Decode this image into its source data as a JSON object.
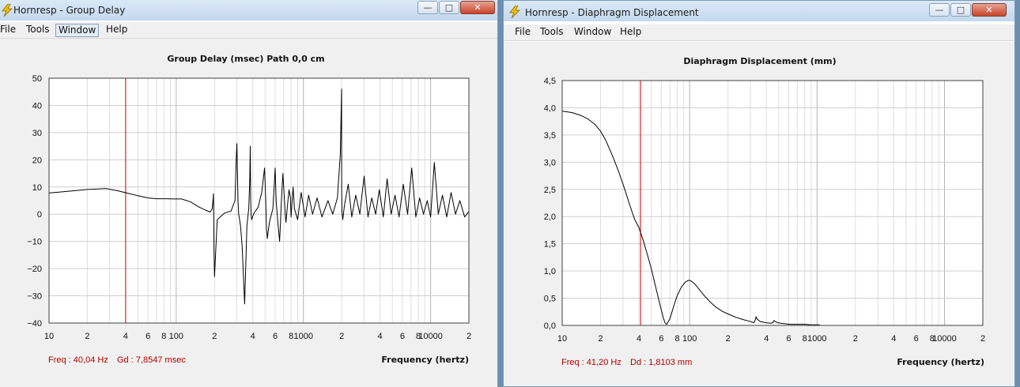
{
  "windows": [
    {
      "title": "Hornresp - Group Delay",
      "menu": [
        "File",
        "Tools",
        "Window",
        "Help"
      ],
      "active_menu": 2,
      "readout": {
        "freq": "Freq : 40,04 Hz",
        "value": "Gd : 7,8547 msec"
      }
    },
    {
      "title": "Hornresp - Diaphragm Displacement",
      "menu": [
        "File",
        "Tools",
        "Window",
        "Help"
      ],
      "active_menu": -1,
      "readout": {
        "freq": "Freq : 41,20 Hz",
        "value": "Dd : 1,8103 mm"
      }
    }
  ],
  "chart_data": [
    {
      "type": "line",
      "title": "Group Delay (msec)    Path 0,0 cm",
      "xlabel": "Frequency (hertz)",
      "ylabel": "",
      "x_scale": "log",
      "xlim": [
        10,
        20000
      ],
      "ylim": [
        -40,
        50
      ],
      "yticks": [
        50,
        40,
        30,
        20,
        10,
        0,
        -10,
        -20,
        -30,
        -40
      ],
      "ytick_labels": [
        "50",
        "40",
        "30",
        "20",
        "10",
        "0",
        "−10",
        "−20",
        "−30",
        "−40"
      ],
      "xtick_values": [
        10,
        20,
        40,
        60,
        80,
        100,
        200,
        400,
        600,
        800,
        1000,
        2000,
        4000,
        6000,
        8000,
        10000,
        20000
      ],
      "xtick_labels": [
        "10",
        "2",
        "4",
        "6",
        "8",
        "100",
        "2",
        "4",
        "6",
        "8",
        "1000",
        "2",
        "4",
        "6",
        "8",
        "10000",
        "2"
      ],
      "grid": true,
      "cursor_x": 40.04,
      "line_color": "#000000",
      "cursor_color": "#cc0000",
      "series": [
        {
          "x": [
            10,
            14,
            20,
            28,
            35,
            40,
            50,
            60,
            70,
            80,
            95,
            110,
            130,
            150,
            170,
            185,
            192,
            195,
            196,
            197,
            198,
            200,
            210,
            240,
            270,
            290,
            296,
            300,
            306,
            310,
            320,
            330,
            345,
            360,
            372,
            378,
            382,
            385,
            388,
            392,
            398,
            410,
            440,
            470,
            495,
            505,
            512,
            520,
            540,
            575,
            590,
            600,
            610,
            630,
            650,
            662,
            670,
            690,
            710,
            722,
            730,
            745,
            770,
            790,
            800,
            810,
            830,
            850,
            900,
            960,
            1030,
            1100,
            1180,
            1280,
            1400,
            1560,
            1700,
            1850,
            1950,
            1995,
            2000,
            2010,
            2040,
            2100,
            2250,
            2400,
            2580,
            2780,
            3000,
            3220,
            3450,
            3700,
            3950,
            4250,
            4550,
            4900,
            5250,
            5650,
            6100,
            6600,
            7100,
            7650,
            8200,
            8800,
            9400,
            10000,
            10700,
            11500,
            12400,
            13400,
            14500,
            15700,
            17000,
            18500,
            20000
          ],
          "y": [
            7.8,
            8.4,
            9.1,
            9.4,
            8.6,
            7.9,
            6.8,
            6.0,
            5.7,
            5.7,
            5.6,
            5.6,
            4.5,
            2.7,
            1.5,
            0.8,
            2.0,
            5.5,
            7.5,
            2.0,
            -12.0,
            -23.0,
            -2.0,
            0.4,
            1.2,
            5.0,
            20.0,
            26.0,
            5.0,
            0.0,
            -4.0,
            -12.0,
            -33.0,
            -4.0,
            2.0,
            12.0,
            25.0,
            6.0,
            0.0,
            -2.0,
            -1.0,
            0.5,
            2.5,
            8.0,
            17.0,
            6.0,
            -5.0,
            -9.0,
            -3.0,
            2.0,
            11.0,
            17.0,
            5.0,
            -3.0,
            -10.0,
            -2.0,
            4.0,
            15.0,
            5.0,
            -1.0,
            -3.0,
            2.0,
            9.0,
            6.0,
            -1.0,
            3.0,
            10.0,
            2.0,
            -2.0,
            8.0,
            -1.0,
            7.0,
            0.0,
            6.0,
            -1.0,
            5.0,
            0.0,
            6.0,
            22.0,
            46.0,
            10.0,
            1.0,
            -2.0,
            3.0,
            11.0,
            -1.0,
            7.0,
            0.0,
            14.0,
            -1.0,
            6.0,
            0.0,
            9.0,
            -1.0,
            13.0,
            0.0,
            7.0,
            -1.0,
            11.0,
            0.0,
            17.0,
            -1.0,
            6.0,
            0.0,
            5.0,
            -1.0,
            19.0,
            0.0,
            7.0,
            -1.0,
            8.0,
            0.0,
            5.0,
            -1.0,
            1.0
          ]
        }
      ]
    },
    {
      "type": "line",
      "title": "Diaphragm Displacement (mm)",
      "xlabel": "Frequency (hertz)",
      "ylabel": "",
      "x_scale": "log",
      "xlim": [
        10,
        20000
      ],
      "ylim": [
        0,
        4.5
      ],
      "yticks": [
        4.5,
        4.0,
        3.5,
        3.0,
        2.5,
        2.0,
        1.5,
        1.0,
        0.5,
        0.0
      ],
      "ytick_labels": [
        "4,5",
        "4,0",
        "3,5",
        "3,0",
        "2,5",
        "2,0",
        "1,5",
        "1,0",
        "0,5",
        "0,0"
      ],
      "xtick_values": [
        10,
        20,
        40,
        60,
        80,
        100,
        200,
        400,
        600,
        800,
        1000,
        2000,
        4000,
        6000,
        8000,
        10000,
        20000
      ],
      "xtick_labels": [
        "10",
        "2",
        "4",
        "6",
        "8",
        "100",
        "2",
        "4",
        "6",
        "8",
        "1000",
        "2",
        "4",
        "6",
        "8",
        "10000",
        "2"
      ],
      "grid": true,
      "cursor_x": 41.2,
      "line_color": "#000000",
      "cursor_color": "#cc0000",
      "series": [
        {
          "x": [
            10,
            12,
            14,
            16,
            18,
            20,
            22,
            25,
            28,
            31,
            34,
            37,
            40,
            43,
            46,
            50,
            54,
            58,
            62,
            64,
            66,
            70,
            75,
            80,
            86,
            92,
            98,
            102,
            110,
            120,
            130,
            145,
            160,
            180,
            200,
            230,
            260,
            300,
            320,
            330,
            332,
            340,
            360,
            400,
            430,
            450,
            460,
            470,
            490,
            520,
            560,
            620,
            700,
            800,
            900,
            1000,
            1050
          ],
          "y": [
            3.94,
            3.91,
            3.86,
            3.79,
            3.7,
            3.57,
            3.4,
            3.1,
            2.8,
            2.5,
            2.2,
            1.95,
            1.8,
            1.58,
            1.35,
            1.05,
            0.72,
            0.42,
            0.15,
            0.05,
            0.02,
            0.12,
            0.35,
            0.55,
            0.7,
            0.79,
            0.83,
            0.82,
            0.76,
            0.65,
            0.55,
            0.43,
            0.34,
            0.26,
            0.21,
            0.15,
            0.11,
            0.07,
            0.05,
            0.12,
            0.16,
            0.11,
            0.07,
            0.05,
            0.04,
            0.05,
            0.09,
            0.07,
            0.05,
            0.04,
            0.03,
            0.02,
            0.02,
            0.02,
            0.01,
            0.01,
            0.01
          ]
        }
      ]
    }
  ]
}
